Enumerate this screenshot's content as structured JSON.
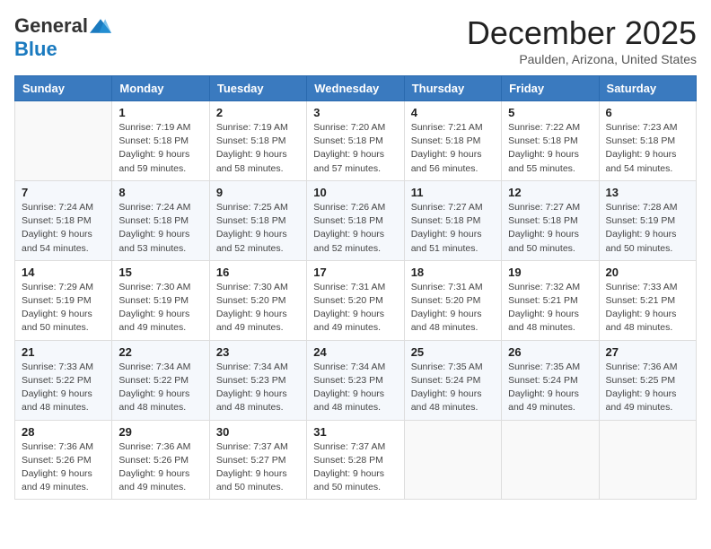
{
  "logo": {
    "general": "General",
    "blue": "Blue"
  },
  "header": {
    "month": "December 2025",
    "location": "Paulden, Arizona, United States"
  },
  "weekdays": [
    "Sunday",
    "Monday",
    "Tuesday",
    "Wednesday",
    "Thursday",
    "Friday",
    "Saturday"
  ],
  "weeks": [
    [
      {
        "day": "",
        "info": ""
      },
      {
        "day": "1",
        "info": "Sunrise: 7:19 AM\nSunset: 5:18 PM\nDaylight: 9 hours\nand 59 minutes."
      },
      {
        "day": "2",
        "info": "Sunrise: 7:19 AM\nSunset: 5:18 PM\nDaylight: 9 hours\nand 58 minutes."
      },
      {
        "day": "3",
        "info": "Sunrise: 7:20 AM\nSunset: 5:18 PM\nDaylight: 9 hours\nand 57 minutes."
      },
      {
        "day": "4",
        "info": "Sunrise: 7:21 AM\nSunset: 5:18 PM\nDaylight: 9 hours\nand 56 minutes."
      },
      {
        "day": "5",
        "info": "Sunrise: 7:22 AM\nSunset: 5:18 PM\nDaylight: 9 hours\nand 55 minutes."
      },
      {
        "day": "6",
        "info": "Sunrise: 7:23 AM\nSunset: 5:18 PM\nDaylight: 9 hours\nand 54 minutes."
      }
    ],
    [
      {
        "day": "7",
        "info": "Sunrise: 7:24 AM\nSunset: 5:18 PM\nDaylight: 9 hours\nand 54 minutes."
      },
      {
        "day": "8",
        "info": "Sunrise: 7:24 AM\nSunset: 5:18 PM\nDaylight: 9 hours\nand 53 minutes."
      },
      {
        "day": "9",
        "info": "Sunrise: 7:25 AM\nSunset: 5:18 PM\nDaylight: 9 hours\nand 52 minutes."
      },
      {
        "day": "10",
        "info": "Sunrise: 7:26 AM\nSunset: 5:18 PM\nDaylight: 9 hours\nand 52 minutes."
      },
      {
        "day": "11",
        "info": "Sunrise: 7:27 AM\nSunset: 5:18 PM\nDaylight: 9 hours\nand 51 minutes."
      },
      {
        "day": "12",
        "info": "Sunrise: 7:27 AM\nSunset: 5:18 PM\nDaylight: 9 hours\nand 50 minutes."
      },
      {
        "day": "13",
        "info": "Sunrise: 7:28 AM\nSunset: 5:19 PM\nDaylight: 9 hours\nand 50 minutes."
      }
    ],
    [
      {
        "day": "14",
        "info": "Sunrise: 7:29 AM\nSunset: 5:19 PM\nDaylight: 9 hours\nand 50 minutes."
      },
      {
        "day": "15",
        "info": "Sunrise: 7:30 AM\nSunset: 5:19 PM\nDaylight: 9 hours\nand 49 minutes."
      },
      {
        "day": "16",
        "info": "Sunrise: 7:30 AM\nSunset: 5:20 PM\nDaylight: 9 hours\nand 49 minutes."
      },
      {
        "day": "17",
        "info": "Sunrise: 7:31 AM\nSunset: 5:20 PM\nDaylight: 9 hours\nand 49 minutes."
      },
      {
        "day": "18",
        "info": "Sunrise: 7:31 AM\nSunset: 5:20 PM\nDaylight: 9 hours\nand 48 minutes."
      },
      {
        "day": "19",
        "info": "Sunrise: 7:32 AM\nSunset: 5:21 PM\nDaylight: 9 hours\nand 48 minutes."
      },
      {
        "day": "20",
        "info": "Sunrise: 7:33 AM\nSunset: 5:21 PM\nDaylight: 9 hours\nand 48 minutes."
      }
    ],
    [
      {
        "day": "21",
        "info": "Sunrise: 7:33 AM\nSunset: 5:22 PM\nDaylight: 9 hours\nand 48 minutes."
      },
      {
        "day": "22",
        "info": "Sunrise: 7:34 AM\nSunset: 5:22 PM\nDaylight: 9 hours\nand 48 minutes."
      },
      {
        "day": "23",
        "info": "Sunrise: 7:34 AM\nSunset: 5:23 PM\nDaylight: 9 hours\nand 48 minutes."
      },
      {
        "day": "24",
        "info": "Sunrise: 7:34 AM\nSunset: 5:23 PM\nDaylight: 9 hours\nand 48 minutes."
      },
      {
        "day": "25",
        "info": "Sunrise: 7:35 AM\nSunset: 5:24 PM\nDaylight: 9 hours\nand 48 minutes."
      },
      {
        "day": "26",
        "info": "Sunrise: 7:35 AM\nSunset: 5:24 PM\nDaylight: 9 hours\nand 49 minutes."
      },
      {
        "day": "27",
        "info": "Sunrise: 7:36 AM\nSunset: 5:25 PM\nDaylight: 9 hours\nand 49 minutes."
      }
    ],
    [
      {
        "day": "28",
        "info": "Sunrise: 7:36 AM\nSunset: 5:26 PM\nDaylight: 9 hours\nand 49 minutes."
      },
      {
        "day": "29",
        "info": "Sunrise: 7:36 AM\nSunset: 5:26 PM\nDaylight: 9 hours\nand 49 minutes."
      },
      {
        "day": "30",
        "info": "Sunrise: 7:37 AM\nSunset: 5:27 PM\nDaylight: 9 hours\nand 50 minutes."
      },
      {
        "day": "31",
        "info": "Sunrise: 7:37 AM\nSunset: 5:28 PM\nDaylight: 9 hours\nand 50 minutes."
      },
      {
        "day": "",
        "info": ""
      },
      {
        "day": "",
        "info": ""
      },
      {
        "day": "",
        "info": ""
      }
    ]
  ]
}
